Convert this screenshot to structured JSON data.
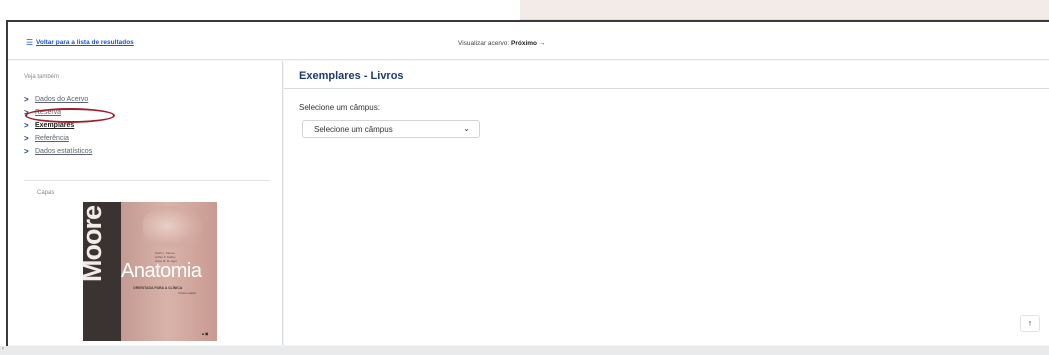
{
  "topbar": {
    "back_link_icon": "list-icon",
    "back_link_label": "Voltar para a lista de resultados",
    "visualizar_prefix": "Visualizar acervo:",
    "visualizar_next": "Próximo →"
  },
  "sidebar": {
    "see_also_label": "Veja também",
    "items": [
      {
        "label": "Dados do Acervo",
        "active": false
      },
      {
        "label": "Reserva",
        "active": false
      },
      {
        "label": "Exemplares",
        "active": true
      },
      {
        "label": "Referência",
        "active": false
      },
      {
        "label": "Dados estatísticos",
        "active": false
      }
    ],
    "capa_label": "Capas",
    "cover": {
      "author": "Moore",
      "title": "Anatomia",
      "subtitle": "ORIENTADA PARA A CLÍNICA",
      "authors_text": "Keith L. Moore\nArthur F. Dalley\nAnne M. R. Agur",
      "edition": "Oitava edição"
    }
  },
  "main": {
    "title": "Exemplares - Livros",
    "campus_label": "Selecione um câmpus:",
    "campus_select_value": "Selecione um câmpus",
    "scroll_top_icon": "arrow-up-icon"
  },
  "colors": {
    "accent": "#1e3a72",
    "link": "#1a56c9",
    "annotation": "#9b1f2a"
  }
}
